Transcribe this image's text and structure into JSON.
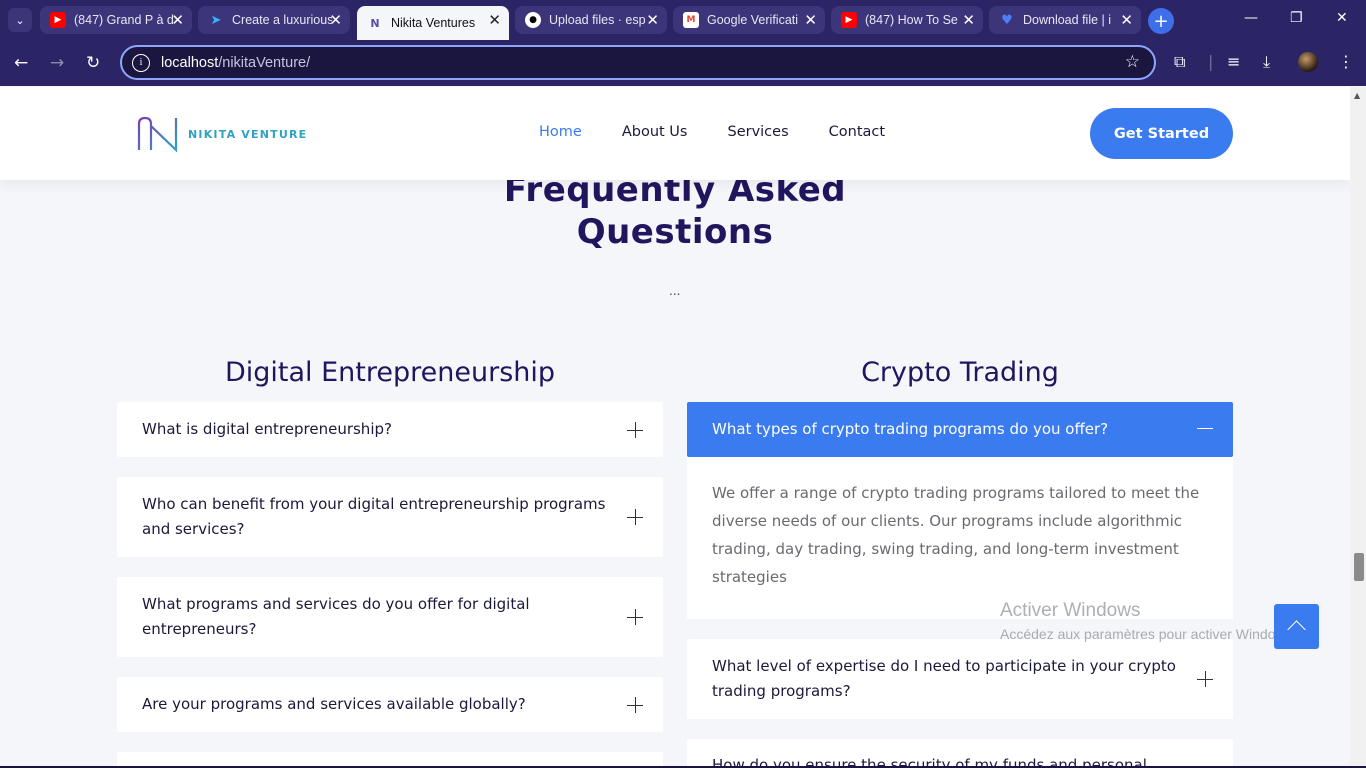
{
  "browser": {
    "tabs": [
      {
        "title": "(847) Grand P à d",
        "icon": "youtube-icon",
        "color": "#ff0000",
        "active": false
      },
      {
        "title": "Create a luxurious",
        "icon": "bird-icon",
        "color": "#3ab0ff",
        "active": false
      },
      {
        "title": "Nikita Ventures",
        "icon": "nikita-logo-icon",
        "color": "#5a4fa8",
        "active": true
      },
      {
        "title": "Upload files · esp",
        "icon": "github-icon",
        "color": "#000000",
        "active": false
      },
      {
        "title": "Google Verificati",
        "icon": "gmail-icon",
        "color": "#ea4335",
        "active": false
      },
      {
        "title": "(847) How To Se",
        "icon": "youtube-icon",
        "color": "#ff0000",
        "active": false
      },
      {
        "title": "Download file | i",
        "icon": "heart-icon",
        "color": "#4d7cff",
        "active": false
      }
    ],
    "url_host": "localhost",
    "url_path": "/nikitaVenture/"
  },
  "site": {
    "logo_text": "NIKITA VENTURE",
    "nav": [
      {
        "label": "Home",
        "active": true
      },
      {
        "label": "About Us",
        "active": false
      },
      {
        "label": "Services",
        "active": false
      },
      {
        "label": "Contact",
        "active": false
      }
    ],
    "cta": "Get Started"
  },
  "faq": {
    "title_line1": "Frequently Asked",
    "title_line2": "Questions",
    "dots": "...",
    "left": {
      "title": "Digital Entrepreneurship",
      "questions": [
        "What is digital entrepreneurship?",
        "Who can benefit from your digital entrepreneurship programs and services?",
        "What programs and services do you offer for digital entrepreneurs?",
        "Are your programs and services available globally?"
      ]
    },
    "right": {
      "title": "Crypto Trading",
      "open_question": "What types of crypto trading programs do you offer?",
      "open_answer": "We offer a range of crypto trading programs tailored to meet the diverse needs of our clients. Our programs include algorithmic trading, day trading, swing trading, and long-term investment strategies",
      "questions": [
        "What level of expertise do I need to participate in your crypto trading programs?",
        "How do you ensure the security of my funds and personal"
      ]
    }
  },
  "watermark": {
    "line1": "Activer Windows",
    "line2": "Accédez aux paramètres pour activer Windows."
  }
}
